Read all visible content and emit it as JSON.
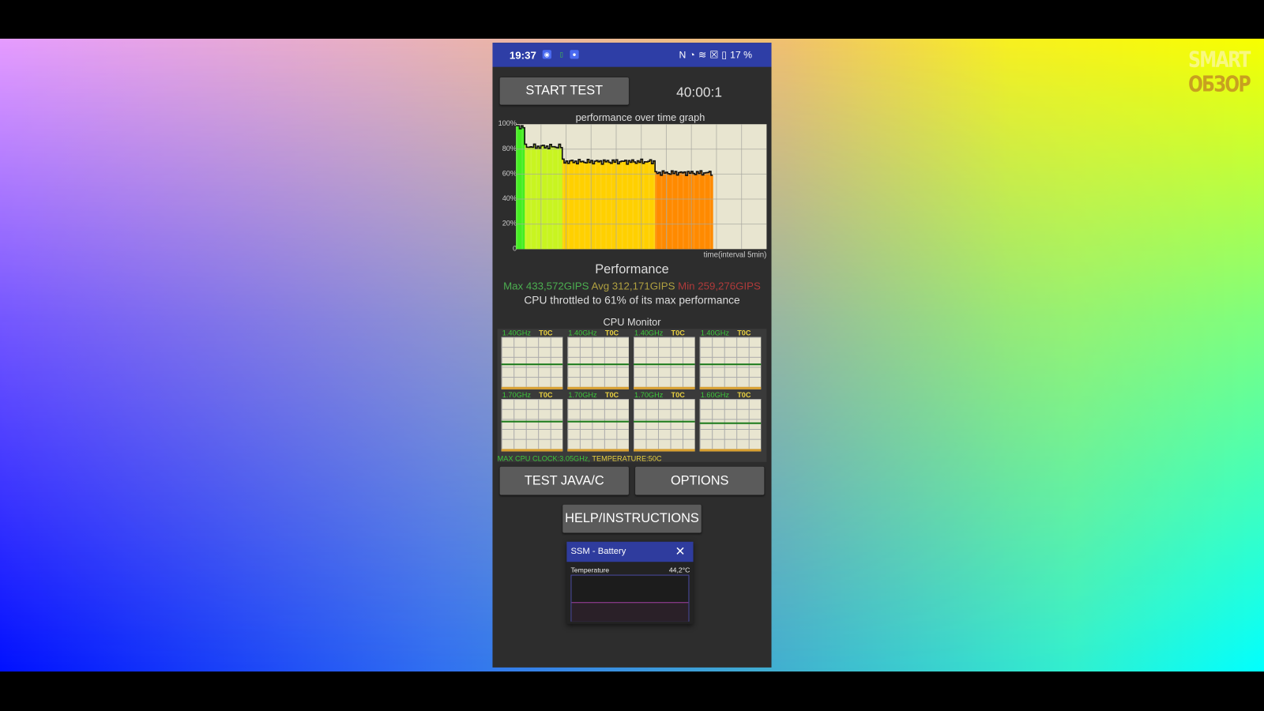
{
  "watermark": {
    "line1": "SMART",
    "line2": "ОБЗОР"
  },
  "status_bar": {
    "time": "19:37",
    "battery": "17 %",
    "icons": [
      "cast-icon",
      "battery-small-icon",
      "settings-icon",
      "nfc-icon",
      "speed-icon",
      "wifi-icon",
      "close-box-icon",
      "battery-icon"
    ]
  },
  "toolbar": {
    "start_label": "START TEST",
    "timer": "40:00:1"
  },
  "chart_data": {
    "type": "bar",
    "title": "performance over time graph",
    "xlabel": "time(interval 5min)",
    "ylabel": "",
    "yticks": [
      "100%",
      "80%",
      "60%",
      "40%",
      "20%",
      "0"
    ],
    "ylim": [
      0,
      100
    ],
    "xlim_intervals": [
      0,
      10
    ],
    "grid": true,
    "segments": [
      {
        "from": 0,
        "to": 0.35,
        "value": 98,
        "color": "#44ee22"
      },
      {
        "from": 0.35,
        "to": 1.85,
        "value": 82,
        "color": "#c8f520"
      },
      {
        "from": 1.85,
        "to": 5.55,
        "value": 70,
        "color": "#ffd000"
      },
      {
        "from": 5.55,
        "to": 7.85,
        "value": 61,
        "color": "#ff8a00"
      }
    ]
  },
  "performance": {
    "title": "Performance",
    "max": "Max 433,572GIPS",
    "avg": "Avg 312,171GIPS",
    "min": "Min 259,276GIPS",
    "throttle": "CPU throttled to 61% of its max performance",
    "colors": {
      "max": "#4caf50",
      "avg": "#b0a040",
      "min": "#b03a3a"
    }
  },
  "cpu_monitor": {
    "title": "CPU Monitor",
    "cores": [
      {
        "freq": "1.40GHz",
        "temp": "T0C",
        "load": 0.45
      },
      {
        "freq": "1.40GHz",
        "temp": "T0C",
        "load": 0.45
      },
      {
        "freq": "1.40GHz",
        "temp": "T0C",
        "load": 0.45
      },
      {
        "freq": "1.40GHz",
        "temp": "T0C",
        "load": 0.45
      },
      {
        "freq": "1.70GHz",
        "temp": "T0C",
        "load": 0.55
      },
      {
        "freq": "1.70GHz",
        "temp": "T0C",
        "load": 0.55
      },
      {
        "freq": "1.70GHz",
        "temp": "T0C",
        "load": 0.55
      },
      {
        "freq": "1.60GHz",
        "temp": "T0C",
        "load": 0.51
      }
    ],
    "max_clock": "MAX CPU CLOCK:3.05GHz,",
    "temperature": "TEMPERATURE:50C"
  },
  "buttons": {
    "test_java": "TEST JAVA/C",
    "options": "OPTIONS",
    "help": "HELP/INSTRUCTIONS"
  },
  "ssm": {
    "title": "SSM - Battery",
    "label": "Temperature",
    "value": "44,2°C"
  }
}
